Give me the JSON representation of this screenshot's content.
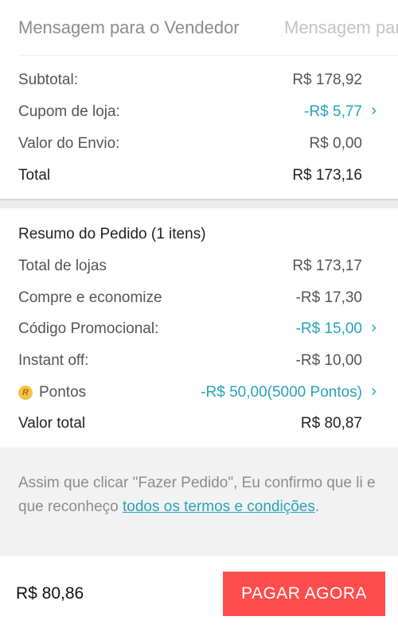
{
  "message": {
    "label": "Mensagem para o Vendedor",
    "placeholder": "Mensagem para o Vendedor"
  },
  "summary": {
    "subtotal_label": "Subtotal:",
    "subtotal_value": "R$ 178,92",
    "coupon_label": "Cupom de loja:",
    "coupon_value": "-R$ 5,77",
    "shipping_label": "Valor do Envio:",
    "shipping_value": "R$ 0,00",
    "total_label": "Total",
    "total_value": "R$ 173,16"
  },
  "order": {
    "heading": "Resumo do Pedido (1 itens)",
    "stores_label": "Total de lojas",
    "stores_value": "R$ 173,17",
    "save_label": "Compre e economize",
    "save_value": "-R$ 17,30",
    "promo_label": "Código Promocional:",
    "promo_value": "-R$ 15,00",
    "instant_label": "Instant off:",
    "instant_value": "-R$ 10,00",
    "points_icon_letter": "R",
    "points_label": "Pontos",
    "points_value": "-R$ 50,00(5000 Pontos)",
    "final_label": "Valor total",
    "final_value": "R$ 80,87"
  },
  "terms": {
    "text": "Assim que clicar \"Fazer Pedido\", Eu confirmo que li e que reconheço ",
    "link": "todos os termos e condições",
    "end": "."
  },
  "footer": {
    "total": "R$ 80,86",
    "pay_label": "PAGAR AGORA"
  },
  "colors": {
    "accent": "#26a4b8",
    "pay_button": "#ff4d4d"
  },
  "icons": {
    "chevron": "chevron-right-icon",
    "points": "coin-icon"
  }
}
